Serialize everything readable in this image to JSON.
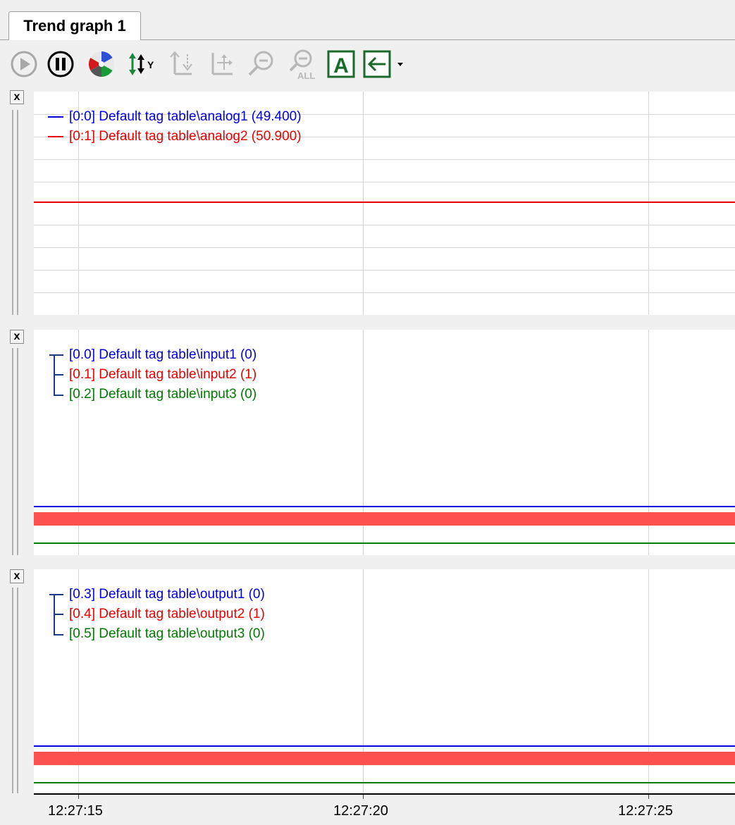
{
  "window": {
    "tab_label": "Trend graph 1"
  },
  "toolbar": {
    "buttons": [
      {
        "name": "start-button",
        "icon": "play-icon",
        "enabled": false
      },
      {
        "name": "stop-button",
        "icon": "pause-icon",
        "enabled": true
      },
      {
        "name": "color-button",
        "icon": "color-wheel-icon",
        "enabled": true
      },
      {
        "name": "y-scale-button",
        "icon": "y-axis-scale-icon",
        "enabled": true
      },
      {
        "name": "axis-button",
        "icon": "axis-icon",
        "enabled": false
      },
      {
        "name": "move-button",
        "icon": "move-icon",
        "enabled": false
      },
      {
        "name": "zoom-out-button",
        "icon": "zoom-out-icon",
        "enabled": false
      },
      {
        "name": "zoom-all-button",
        "icon": "zoom-all-icon",
        "enabled": false
      },
      {
        "name": "font-button",
        "icon": "font-a-icon",
        "enabled": true
      },
      {
        "name": "back-button",
        "icon": "arrow-left-icon",
        "enabled": true
      }
    ],
    "zoom_all_label": "ALL",
    "font_label": "A"
  },
  "colors": {
    "blue": "#0000e0",
    "red": "#e80000",
    "green": "#007a00",
    "red_fill": "#ff5050"
  },
  "panes": [
    {
      "legend": [
        {
          "label": "[0:0] Default tag table\\analog1 (49.400)",
          "color": "blue"
        },
        {
          "label": "[0:1] Default tag table\\analog2 (50.900)",
          "color": "red"
        }
      ]
    },
    {
      "legend": [
        {
          "label": "[0.0] Default tag table\\input1 (0)",
          "color": "blue"
        },
        {
          "label": "[0.1] Default tag table\\input2 (1)",
          "color": "red"
        },
        {
          "label": "[0.2] Default tag table\\input3 (0)",
          "color": "green"
        }
      ]
    },
    {
      "legend": [
        {
          "label": "[0.3] Default tag table\\output1 (0)",
          "color": "blue"
        },
        {
          "label": "[0.4] Default tag table\\output2 (1)",
          "color": "red"
        },
        {
          "label": "[0.5] Default tag table\\output3 (0)",
          "color": "green"
        }
      ]
    }
  ],
  "time_axis": {
    "ticks": [
      "12:27:15",
      "12:27:20",
      "12:27:25"
    ]
  },
  "close_label": "x"
}
